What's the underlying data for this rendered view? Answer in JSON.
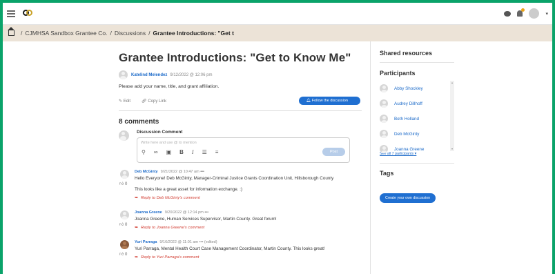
{
  "header": {
    "menu_icon": "hamburger-icon",
    "logo_icon": "logo-icon",
    "right_icons": [
      "chat-icon",
      "bell-icon",
      "avatar",
      "chevron-down-icon"
    ],
    "notification_color": "#e9a216"
  },
  "breadcrumb": {
    "home_icon": "home-icon",
    "items": [
      "CJMHSA Sandbox Grantee Co.",
      "Discussions",
      "Grantee Introductions: \"Get t"
    ]
  },
  "discussion": {
    "title": "Grantee Introductions: \"Get to Know Me\"",
    "author": "Katelind Melendez",
    "date": "9/12/2022 @ 12:06 pm",
    "body": "Please add your name, title, and grant affiliation.",
    "edit_label": "Edit",
    "copy_link_label": "Copy Link",
    "follow_label": "Follow the discussion"
  },
  "comments_section": {
    "heading": "8 comments",
    "compose_label": "Discussion Comment",
    "placeholder": "Write here and use @ to mention",
    "toolbar": [
      "attach-icon",
      "link-icon",
      "image-icon",
      "B",
      "I",
      "bullet-list-icon",
      "numbered-list-icon"
    ],
    "post_label": "Post"
  },
  "comments": [
    {
      "author": "Deb McGinty",
      "date": "9/21/2022 @ 10:47 am",
      "more": "•••",
      "likes": "0",
      "text": "Hello Everyone!  Deb McGinty, Manager-Criminal Justice Grants Coordination Unit, Hillsborough County",
      "text2": "This looks like a great asset for information exchange. :)",
      "reply": "Reply to Deb McGinty's comment"
    },
    {
      "author": "Joanna Greene",
      "date": "9/20/2022 @ 12:14 pm",
      "more": "•••",
      "likes": "0",
      "text": "Joanna Greene, Human Services Supervisor, Martin County.  Great forum!",
      "reply": "Reply to Joanna Greene's comment"
    },
    {
      "author": "Yuri Parraga",
      "date": "9/16/2022 @ 11:01 am",
      "more": "•••",
      "edited": "(edited)",
      "likes": "0",
      "text": "Yuri Parraga, Mental Health Court Case Management Coordinator, Martin County. This looks great!",
      "reply": "Reply to Yuri Parraga's comment"
    }
  ],
  "sidebar": {
    "shared_resources": "Shared resources",
    "participants_heading": "Participants",
    "participants": [
      "Abby Shockley",
      "Audrey Dillhoff",
      "Beth Holland",
      "Deb McGinty",
      "Joanna Greene"
    ],
    "see_all": "See all 7 participants",
    "tags_heading": "Tags",
    "create_label": "Create your own discussion"
  }
}
